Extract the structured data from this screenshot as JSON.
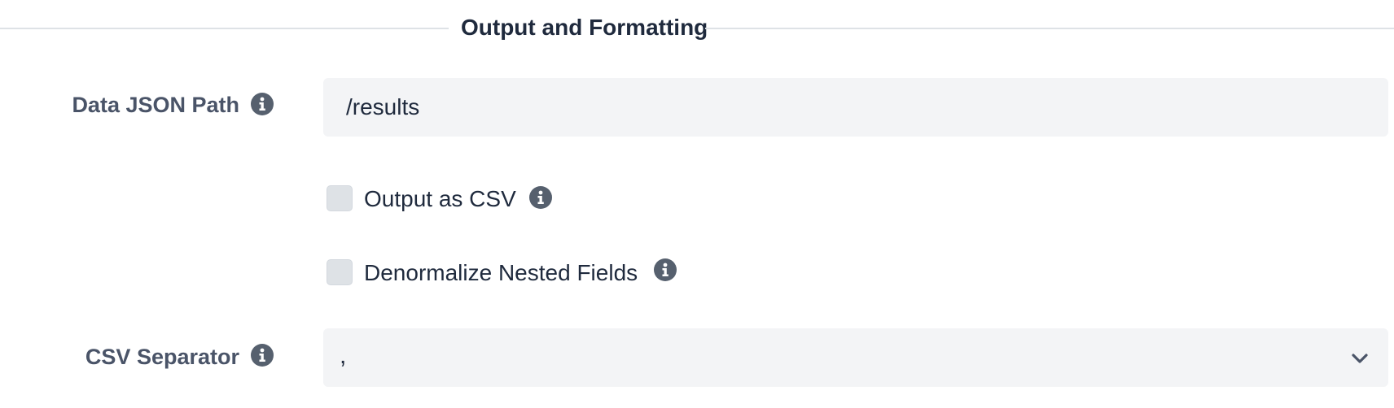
{
  "section": {
    "title": "Output and Formatting"
  },
  "fields": {
    "data_json_path": {
      "label": "Data JSON Path",
      "value": "/results"
    },
    "output_as_csv": {
      "label": "Output as CSV",
      "checked": false
    },
    "denormalize_nested_fields": {
      "label": "Denormalize Nested Fields",
      "checked": false
    },
    "csv_separator": {
      "label": "CSV Separator",
      "value": ","
    }
  },
  "icons": {
    "info": "info-circle-icon",
    "dropdown": "chevron-down-icon"
  },
  "colors": {
    "label_text": "#4a5468",
    "body_text": "#1f2a3d",
    "input_background": "#f3f4f6",
    "icon": "#56606e",
    "divider": "#dee2e6"
  }
}
